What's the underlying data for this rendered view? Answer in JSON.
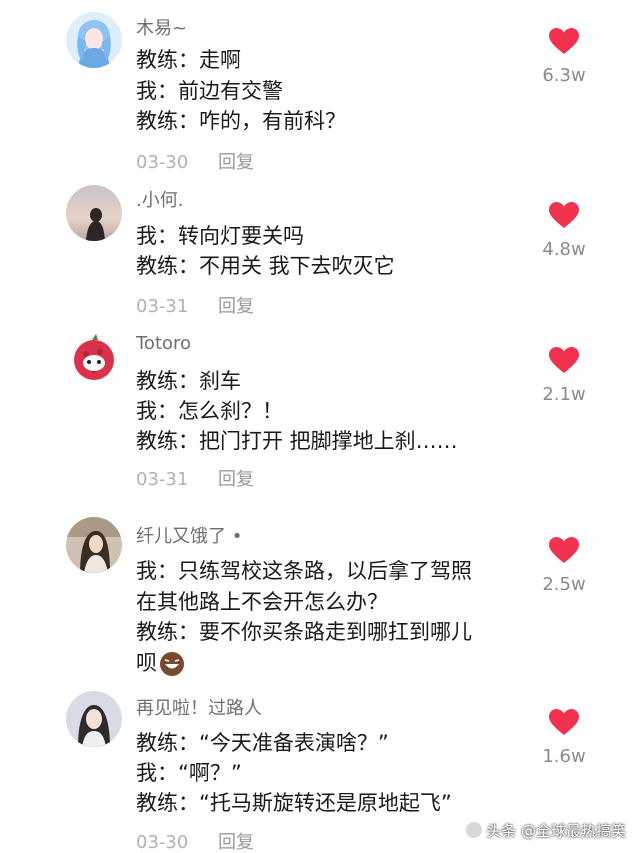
{
  "colors": {
    "heart": "#f0324f",
    "username": "#6f6f6f",
    "meta": "#b2b2b2"
  },
  "comments": [
    {
      "username": "木易~",
      "lines": [
        "教练：走啊",
        "我：前边有交警",
        "教练：咋的，有前科？"
      ],
      "date": "03-30",
      "reply": "回复",
      "likes": "6.3w",
      "avatar_icon": "anime-girl-avatar-icon"
    },
    {
      "username": ".小何.",
      "lines": [
        "我：转向灯要关吗",
        "教练：不用关 我下去吹灭它"
      ],
      "date": "03-31",
      "reply": "回复",
      "likes": "4.8w",
      "avatar_icon": "sunset-silhouette-avatar-icon"
    },
    {
      "username": "Totoro",
      "lines": [
        "教练：刹车",
        "我：怎么刹？！",
        "教练：把门打开 把脚撑地上刹……"
      ],
      "date": "03-31",
      "reply": "回复",
      "likes": "2.1w",
      "avatar_icon": "lychee-character-avatar-icon"
    },
    {
      "username": "纤儿又饿了 •",
      "lines": [
        "我：只练驾校这条路，以后拿了驾照",
        "在其他路上不会开怎么办？",
        "教练：要不你买条路走到哪扛到哪儿",
        "呗"
      ],
      "date": "",
      "reply": "",
      "likes": "2.5w",
      "avatar_icon": "girl-photo-avatar-icon"
    },
    {
      "username": "再见啦！过路人",
      "lines": [
        "教练：“今天准备表演啥？”",
        "我：“啊？”",
        "教练：“托马斯旋转还是原地起飞”"
      ],
      "date": "03-30",
      "reply": "回复",
      "likes": "1.6w",
      "avatar_icon": "girl-portrait-avatar-icon"
    }
  ],
  "watermark": "头条 @全球最热搞笑"
}
